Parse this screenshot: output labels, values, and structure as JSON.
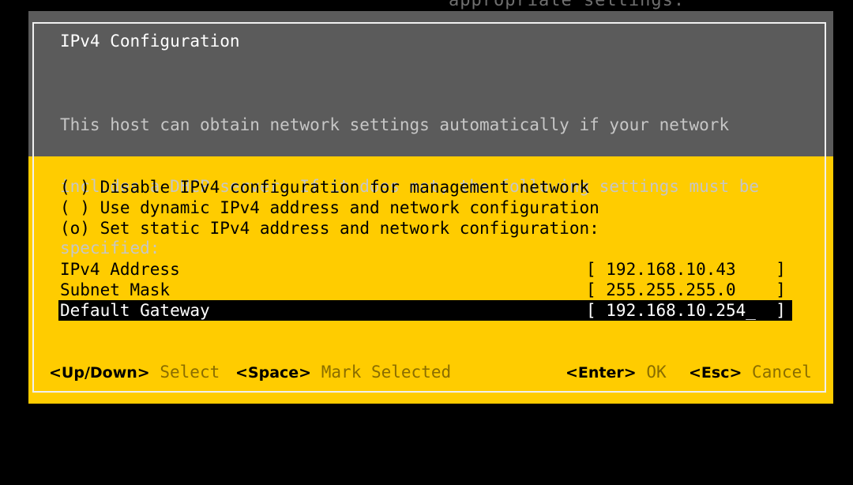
{
  "background_text": "appropriate settings.",
  "dialog": {
    "title": "IPv4 Configuration",
    "description": [
      "This host can obtain network settings automatically if your network",
      "includes a DHCP server. If it does not, the following settings must be",
      "specified:"
    ],
    "options": [
      {
        "marker": "( )",
        "label": "Disable IPv4 configuration for management network",
        "selected": false
      },
      {
        "marker": "( )",
        "label": "Use dynamic IPv4 address and network configuration",
        "selected": false
      },
      {
        "marker": "(o)",
        "label": "Set static IPv4 address and network configuration:",
        "selected": true
      }
    ],
    "fields": [
      {
        "label": "IPv4 Address",
        "value": "[ 192.168.10.43    ]"
      },
      {
        "label": "Subnet Mask",
        "value": "[ 255.255.255.0    ]"
      },
      {
        "label": "Default Gateway",
        "value": "[ 192.168.10.254_  ]",
        "focused": true
      }
    ]
  },
  "footer": {
    "updown_key": "<Up/Down>",
    "updown_action": "Select",
    "space_key": "<Space>",
    "space_action": "Mark Selected",
    "enter_key": "<Enter>",
    "enter_action": "OK",
    "esc_key": "<Esc>",
    "esc_action": "Cancel"
  },
  "colors": {
    "header_bg": "#5b5b5b",
    "body_bg": "#ffcc00",
    "selection_bg": "#000000",
    "action_text": "#8a6d00"
  }
}
